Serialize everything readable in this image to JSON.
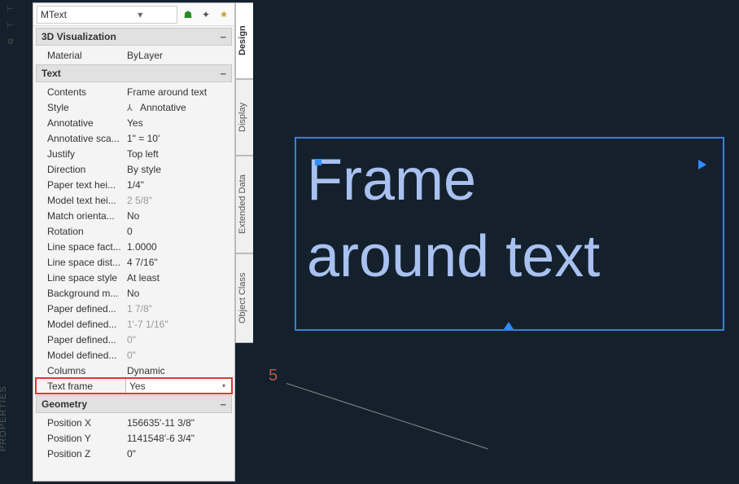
{
  "props_label": "PROPERTIES",
  "header": {
    "object_type": "MText"
  },
  "vtabs": {
    "design": "Design",
    "display": "Display",
    "extended": "Extended Data",
    "object_class": "Object Class"
  },
  "sections": {
    "vis3d": {
      "title": "3D Visualization",
      "rows": {
        "material_label": "Material",
        "material_value": "ByLayer"
      }
    },
    "text": {
      "title": "Text",
      "rows": {
        "contents_label": "Contents",
        "contents_value": "Frame around text",
        "style_label": "Style",
        "style_value": "Annotative",
        "annotative_label": "Annotative",
        "annotative_value": "Yes",
        "annoscale_label": "Annotative sca...",
        "annoscale_value": "1\" = 10'",
        "justify_label": "Justify",
        "justify_value": "Top left",
        "direction_label": "Direction",
        "direction_value": "By style",
        "paperht_label": "Paper text hei...",
        "paperht_value": "1/4\"",
        "modelht_label": "Model text hei...",
        "modelht_value": "2 5/8\"",
        "matchorient_label": "Match orienta...",
        "matchorient_value": "No",
        "rotation_label": "Rotation",
        "rotation_value": "0",
        "lsf_label": "Line space fact...",
        "lsf_value": "1.0000",
        "lsd_label": "Line space dist...",
        "lsd_value": "4 7/16\"",
        "lss_label": "Line space style",
        "lss_value": "At least",
        "bg_label": "Background m...",
        "bg_value": "No",
        "pdw_label": "Paper  defined...",
        "pdw_value": "1 7/8\"",
        "mdw_label": "Model  defined...",
        "mdw_value": "1'-7 1/16\"",
        "pdh_label": "Paper  defined...",
        "pdh_value": "0\"",
        "mdh_label": "Model  defined...",
        "mdh_value": "0\"",
        "columns_label": "Columns",
        "columns_value": "Dynamic",
        "textframe_label": "Text frame",
        "textframe_value": "Yes"
      }
    },
    "geometry": {
      "title": "Geometry",
      "rows": {
        "px_label": "Position X",
        "px_value": "156635'-11 3/8\"",
        "py_label": "Position Y",
        "py_value": "1141548'-6 3/4\"",
        "pz_label": "Position Z",
        "pz_value": "0\""
      }
    }
  },
  "canvas": {
    "text_line1": "Frame",
    "text_line2": "around text",
    "dim_number": "5"
  }
}
